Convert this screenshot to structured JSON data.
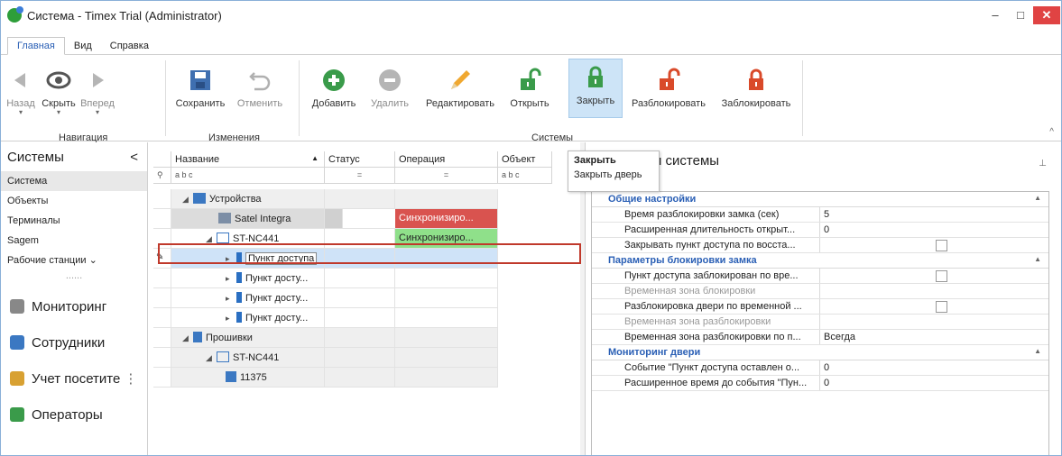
{
  "window": {
    "title": "Система - Timex Trial (Administrator)",
    "min": "–",
    "max": "□",
    "close": "✕"
  },
  "tabs": [
    {
      "label": "Главная"
    },
    {
      "label": "Вид"
    },
    {
      "label": "Справка"
    }
  ],
  "ribbon": {
    "back": "Назад",
    "hide": "Скрыть",
    "forward": "Вперед",
    "save": "Сохранить",
    "cancel": "Отменить",
    "add": "Добавить",
    "delete": "Удалить",
    "edit": "Редактировать",
    "open": "Открыть",
    "close": "Закрыть",
    "unblock": "Разблокировать",
    "block": "Заблокировать",
    "groups": {
      "nav": "Навигация",
      "changes": "Изменения",
      "systems": "Системы"
    }
  },
  "tooltip": {
    "title": "Закрыть",
    "desc": "Закрыть дверь"
  },
  "nav": {
    "header": "Системы",
    "collapse": "<",
    "items": [
      "Система",
      "Объекты",
      "Терминалы",
      "Sagem",
      "Рабочие станции"
    ],
    "dots": "......",
    "big": [
      "Мониторинг",
      "Сотрудники",
      "Учет посетите",
      "Операторы"
    ]
  },
  "grid": {
    "columns": [
      "Название",
      "Статус",
      "Операция",
      "Объект"
    ],
    "sort_arrow": "▲",
    "filter_abc": "a b c",
    "filter_eq": "=",
    "rows": [
      {
        "name": "Устройства",
        "status": "",
        "op": "",
        "obj": ""
      },
      {
        "name": "Satel Integra",
        "status": "",
        "op": "Синхронизиро...",
        "obj": ""
      },
      {
        "name": "ST-NC441",
        "status": "",
        "op": "Синхронизиро...",
        "obj": ""
      },
      {
        "name": "Пункт доступа",
        "status": "",
        "op": "",
        "obj": ""
      },
      {
        "name": "Пункт досту...",
        "status": "",
        "op": "",
        "obj": ""
      },
      {
        "name": "Пункт досту...",
        "status": "",
        "op": "",
        "obj": ""
      },
      {
        "name": "Пункт досту...",
        "status": "",
        "op": "",
        "obj": ""
      },
      {
        "name": "Прошивки",
        "status": "",
        "op": "",
        "obj": ""
      },
      {
        "name": "ST-NC441",
        "status": "",
        "op": "",
        "obj": ""
      },
      {
        "name": "11375",
        "status": "",
        "op": "",
        "obj": ""
      }
    ]
  },
  "props": {
    "header": "и системы",
    "pin": "⊥",
    "categories": [
      {
        "title": "Общие настройки",
        "rows": [
          {
            "name": "Время разблокировки замка (сек)",
            "value": "5"
          },
          {
            "name": "Расширенная длительность открыт...",
            "value": "0"
          },
          {
            "name": "Закрывать пункт доступа по восста...",
            "value": ""
          }
        ]
      },
      {
        "title": "Параметры блокировки замка",
        "rows": [
          {
            "name": "Пункт доступа заблокирован по вре...",
            "value": ""
          },
          {
            "name": "Временная зона блокировки",
            "value": ""
          },
          {
            "name": "Разблокировка двери по временной ...",
            "value": ""
          },
          {
            "name": "Временная зона разблокировки",
            "value": ""
          },
          {
            "name": "Временная зона разблокировки по п...",
            "value": "Всегда"
          }
        ]
      },
      {
        "title": "Мониторинг двери",
        "rows": [
          {
            "name": "Событие \"Пункт доступа оставлен о...",
            "value": "0"
          },
          {
            "name": "Расширенное время до события \"Пун...",
            "value": "0"
          }
        ]
      }
    ]
  },
  "colors": {
    "accent": "#2a5fb5",
    "error": "#d9534f",
    "ok": "#8fe08a",
    "close_btn": "#e04343"
  }
}
